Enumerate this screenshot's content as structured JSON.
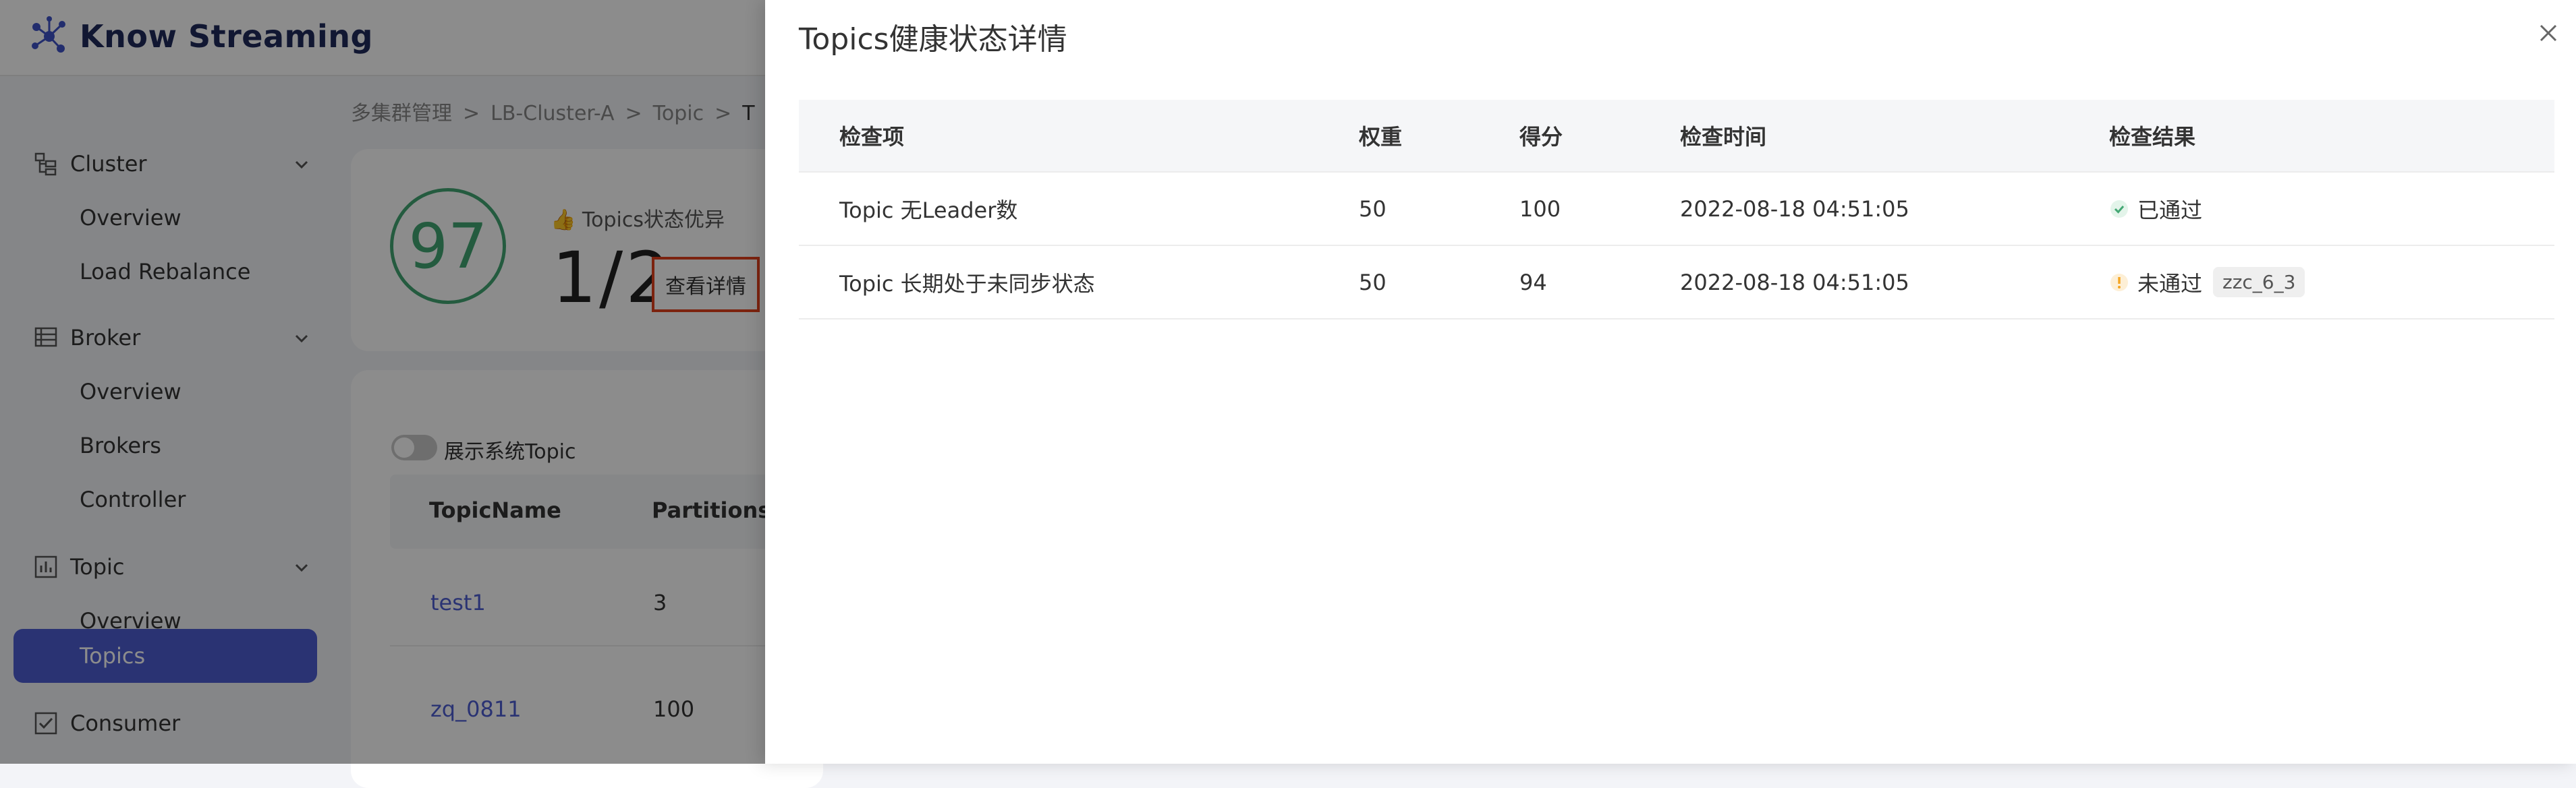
{
  "app": {
    "name": "Know Streaming"
  },
  "sidebar": {
    "groups": [
      {
        "label": "Cluster",
        "items": [
          "Overview",
          "Load Rebalance"
        ]
      },
      {
        "label": "Broker",
        "items": [
          "Overview",
          "Brokers",
          "Controller"
        ]
      },
      {
        "label": "Topic",
        "items": [
          "Overview",
          "Topics"
        ]
      },
      {
        "label": "Consumer",
        "items": []
      }
    ],
    "active_item": "Topics"
  },
  "breadcrumb": {
    "items": [
      "多集群管理",
      "LB-Cluster-A",
      "Topic",
      "T"
    ],
    "separator": ">"
  },
  "health_card": {
    "score": "97",
    "status_label": "👍 Topics状态优异",
    "ratio": "1/2",
    "detail_button": "查看详情"
  },
  "topic_list": {
    "toggle_label": "展示系统Topic",
    "toggle_on": false,
    "columns": [
      "TopicName",
      "Partitions"
    ],
    "rows": [
      {
        "name": "test1",
        "partitions": "3"
      },
      {
        "name": "zq_0811",
        "partitions": "100"
      }
    ]
  },
  "drawer": {
    "title": "Topics健康状态详情",
    "columns": [
      "检查项",
      "权重",
      "得分",
      "检查时间",
      "检查结果"
    ],
    "rows": [
      {
        "item": "Topic 无Leader数",
        "weight": "50",
        "score": "100",
        "time": "2022-08-18 04:51:05",
        "result": "已通过",
        "status": "pass",
        "tag": ""
      },
      {
        "item": "Topic 长期处于未同步状态",
        "weight": "50",
        "score": "94",
        "time": "2022-08-18 04:51:05",
        "result": "未通过",
        "status": "fail",
        "tag": "zzc_6_3"
      }
    ]
  },
  "colors": {
    "primary": "#4e5ed2",
    "success": "#43a773",
    "warning": "#f5a623",
    "highlight_border": "#e2401c"
  },
  "icons": {
    "close": "close-icon",
    "pass": "check-circle-icon",
    "fail": "exclamation-circle-icon"
  }
}
